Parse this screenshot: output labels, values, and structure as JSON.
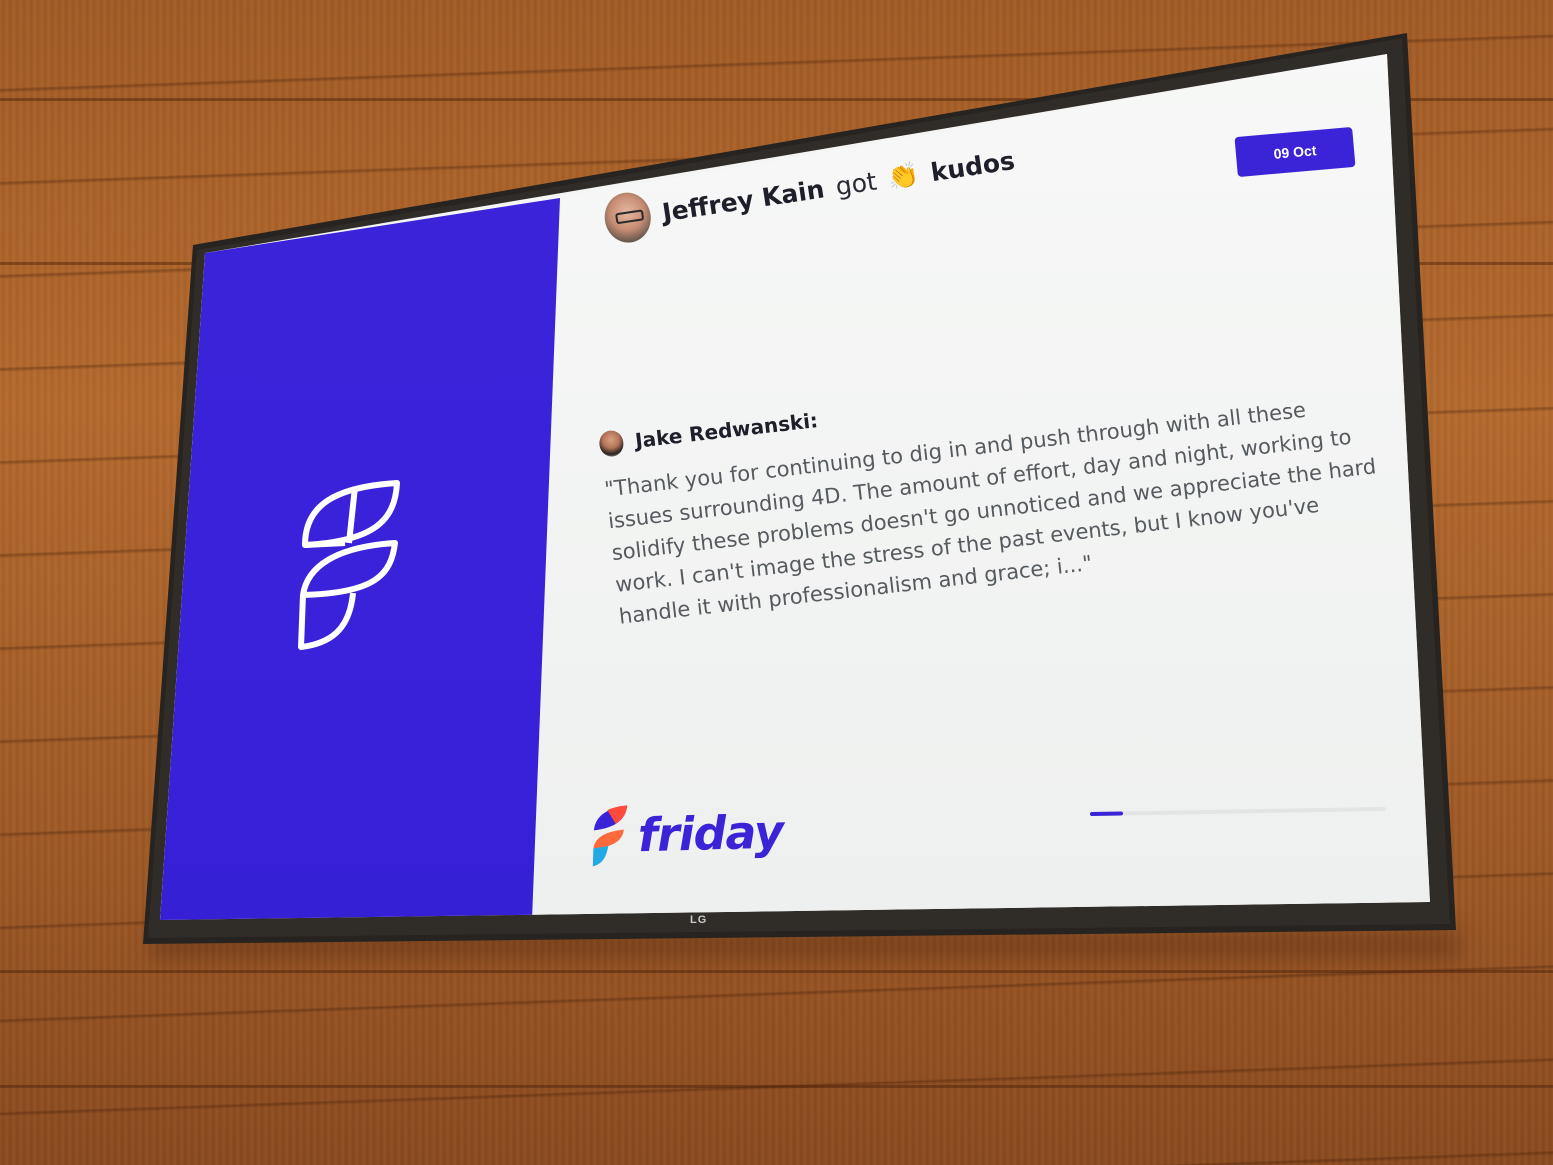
{
  "date_badge": "09 Oct",
  "headline": {
    "name": "Jeffrey Kain",
    "verb": "got",
    "emoji": "👏",
    "word": "kudos"
  },
  "quote": {
    "author": "Jake Redwanski:",
    "lines": [
      "\"Thank you for continuing to dig in and push through with all these",
      "issues surrounding 4D. The amount of effort, day and night, working to",
      "solidify these problems doesn't go unnoticed and we appreciate the hard",
      "work. I can't image the stress of the past events, but I know you've",
      "handle it with professionalism and grace; i...\""
    ]
  },
  "brand": {
    "name": "friday",
    "accent_color": "#3b24d8"
  },
  "tv_brand": "LG",
  "progress": {
    "fraction": 0.11
  }
}
